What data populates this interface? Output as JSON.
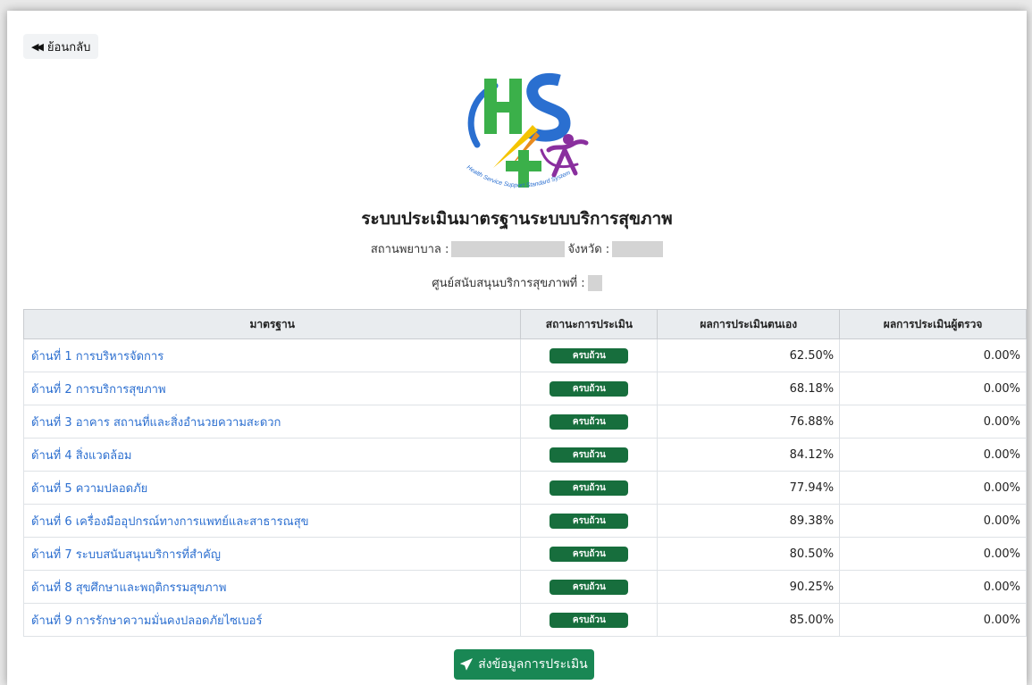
{
  "back_button": {
    "label": "ย้อนกลับ",
    "icon": "backward-icon"
  },
  "logo": {
    "text": "HS4",
    "tagline": "Health Service Support Standard System",
    "colors": {
      "blue": "#2a6fd0",
      "green": "#3bb04a",
      "purple": "#8a2f9e",
      "yellow": "#f5c400"
    }
  },
  "title": "ระบบประเมินมาตรฐานระบบบริการสุขภาพ",
  "info": {
    "hospital_label": "สถานพยาบาล :",
    "province_label": "จังหวัด :",
    "center_label": "ศูนย์สนับสนุนบริการสุขภาพที่ :"
  },
  "table": {
    "headers": [
      "มาตรฐาน",
      "สถานะการประเมิน",
      "ผลการประเมินตนเอง",
      "ผลการประเมินผู้ตรวจ"
    ],
    "rows": [
      {
        "name": "ด้านที่ 1 การบริหารจัดการ",
        "status": "ครบถ้วน",
        "self": "62.50%",
        "inspector": "0.00%"
      },
      {
        "name": "ด้านที่ 2 การบริการสุขภาพ",
        "status": "ครบถ้วน",
        "self": "68.18%",
        "inspector": "0.00%"
      },
      {
        "name": "ด้านที่ 3 อาคาร สถานที่และสิ่งอำนวยความสะดวก",
        "status": "ครบถ้วน",
        "self": "76.88%",
        "inspector": "0.00%"
      },
      {
        "name": "ด้านที่ 4 สิ่งแวดล้อม",
        "status": "ครบถ้วน",
        "self": "84.12%",
        "inspector": "0.00%"
      },
      {
        "name": "ด้านที่ 5 ความปลอดภัย",
        "status": "ครบถ้วน",
        "self": "77.94%",
        "inspector": "0.00%"
      },
      {
        "name": "ด้านที่ 6 เครื่องมืออุปกรณ์ทางการแพทย์และสาธารณสุข",
        "status": "ครบถ้วน",
        "self": "89.38%",
        "inspector": "0.00%"
      },
      {
        "name": "ด้านที่ 7 ระบบสนับสนุนบริการที่สำคัญ",
        "status": "ครบถ้วน",
        "self": "80.50%",
        "inspector": "0.00%"
      },
      {
        "name": "ด้านที่ 8 สุขศึกษาและพฤติกรรมสุขภาพ",
        "status": "ครบถ้วน",
        "self": "90.25%",
        "inspector": "0.00%"
      },
      {
        "name": "ด้านที่ 9 การรักษาความมั่นคงปลอดภัยไซเบอร์",
        "status": "ครบถ้วน",
        "self": "85.00%",
        "inspector": "0.00%"
      }
    ]
  },
  "submit_button": {
    "label": "ส่งข้อมูลการประเมิน",
    "icon": "paper-plane-icon"
  },
  "colors": {
    "badge": "#176e3d",
    "submit": "#198754",
    "link": "#2c6fd0"
  }
}
